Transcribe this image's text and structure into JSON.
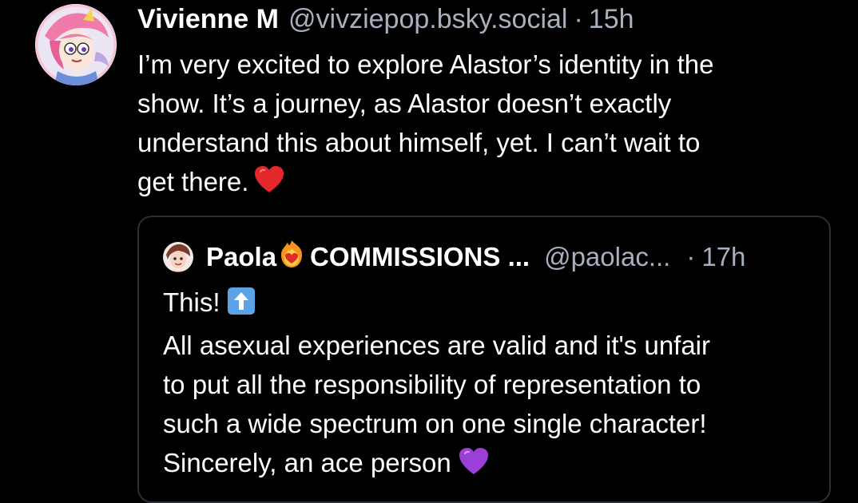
{
  "post": {
    "author_name": "Vivienne M",
    "handle": "@vivziepop.bsky.social",
    "separator": "·",
    "time": "15h",
    "text_lines": [
      "I’m very excited to explore Alastor’s identity in the",
      "show. It’s a journey, as Alastor doesn’t exactly",
      "understand this about himself, yet. I can’t wait to",
      "get there."
    ],
    "avatar_icon": "avatar-illustration",
    "emoji": "red-heart-icon"
  },
  "quote": {
    "author_name": "Paola",
    "author_suffix": "COMMISSIONS ...",
    "handle": "@paolac...",
    "separator": "·",
    "time": "17h",
    "line1": "This!",
    "text_lines": [
      "All asexual experiences are valid and it's unfair",
      "to put all the responsibility of representation to",
      "such a wide spectrum on one single character!",
      "Sincerely, an ace person"
    ],
    "emoji_arrow": "up-arrow-icon",
    "emoji_heart": "purple-heart-icon",
    "name_emoji": "fire-heart-icon"
  },
  "colors": {
    "background": "#000000",
    "text": "#ffffff",
    "muted": "#a6b0bf",
    "card_border": "#2b3038",
    "heart_red": "#e3272b",
    "heart_purple": "#9b3fd6",
    "arrow_blue": "#5ba3e6"
  }
}
